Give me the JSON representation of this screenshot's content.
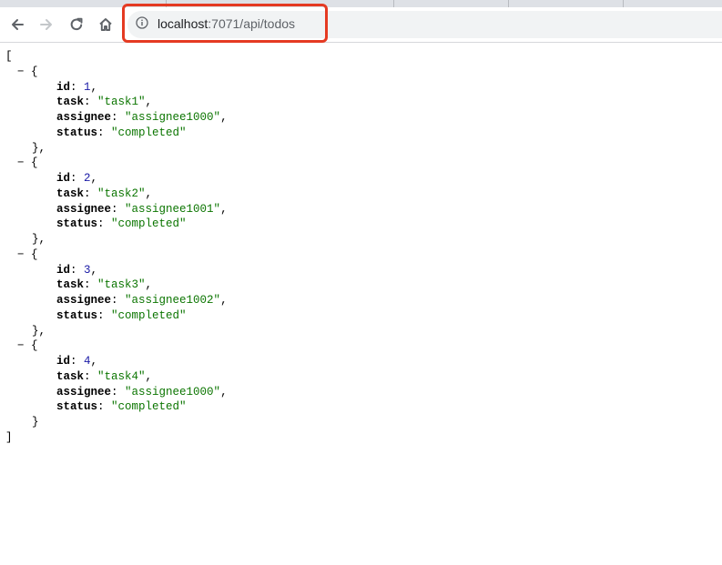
{
  "browser": {
    "back_icon": "arrow-left-icon",
    "forward_icon": "arrow-right-icon",
    "reload_icon": "reload-icon",
    "home_icon": "home-icon",
    "info_icon": "info-icon",
    "address": {
      "host": "localhost",
      "path": ":7071/api/todos"
    },
    "highlight_color": "#e53a22"
  },
  "json": {
    "open_bracket": "[",
    "close_bracket": "]",
    "toggle": "−",
    "items": [
      {
        "id": "1",
        "task": "\"task1\"",
        "assignee": "\"assignee1000\"",
        "status": "\"completed\""
      },
      {
        "id": "2",
        "task": "\"task2\"",
        "assignee": "\"assignee1001\"",
        "status": "\"completed\""
      },
      {
        "id": "3",
        "task": "\"task3\"",
        "assignee": "\"assignee1002\"",
        "status": "\"completed\""
      },
      {
        "id": "4",
        "task": "\"task4\"",
        "assignee": "\"assignee1000\"",
        "status": "\"completed\""
      }
    ],
    "keys": {
      "id": "id",
      "task": "task",
      "assignee": "assignee",
      "status": "status"
    }
  }
}
